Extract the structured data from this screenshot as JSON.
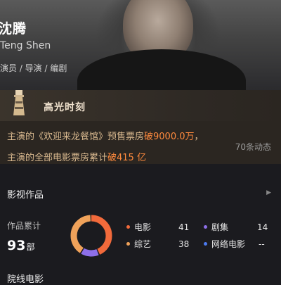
{
  "profile": {
    "name": "沈腾",
    "pinyin": "Teng Shen",
    "roles": "演员 / 导演 / 编剧"
  },
  "highlight": {
    "title": "高光时刻",
    "line1_prefix": "主演的《欢迎来龙餐馆》预售票房",
    "line1_highlight": "破9000.0万",
    "line1_suffix": "，",
    "line2_prefix": "主演的全部电影票房累计",
    "line2_highlight": "破415 亿",
    "more": "70条动态",
    "accent_color": "#ff8a3d",
    "text_color": "#d9b98f"
  },
  "works": {
    "title": "影视作品",
    "arrow_icon": "right-triangle-icon",
    "count_label": "作品累计",
    "count_value": "93",
    "count_unit": "部",
    "categories": [
      {
        "name": "电影",
        "value": "41",
        "color": "#f26a3b"
      },
      {
        "name": "剧集",
        "value": "14",
        "color": "#8d6fe8"
      },
      {
        "name": "综艺",
        "value": "38",
        "color": "#f0a25a"
      },
      {
        "name": "网络电影",
        "value": "--",
        "color": "#4c7bf0"
      }
    ]
  },
  "cinema": {
    "title": "院线电影"
  },
  "chart_data": {
    "type": "pie",
    "categories": [
      "电影",
      "剧集",
      "综艺",
      "网络电影"
    ],
    "values": [
      41,
      14,
      38,
      0
    ]
  }
}
